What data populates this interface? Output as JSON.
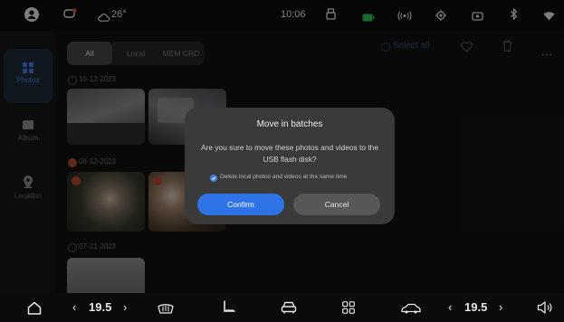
{
  "status_bar": {
    "weather": "26°",
    "time": "10:06"
  },
  "sidebar": {
    "items": [
      {
        "label": "Photos",
        "icon": "photos-icon",
        "active": true
      },
      {
        "label": "Album",
        "icon": "album-icon",
        "active": false
      },
      {
        "label": "Location",
        "icon": "location-icon",
        "active": false
      }
    ]
  },
  "gallery": {
    "tabs": [
      {
        "label": "All",
        "active": true
      },
      {
        "label": "Local",
        "active": false
      },
      {
        "label": "MEM CRD",
        "active": false
      }
    ],
    "toolbar": {
      "select_all": "Select all"
    },
    "groups": [
      {
        "date": "10-12-2023",
        "selected": false
      },
      {
        "date": "08-12-2023",
        "selected": true
      },
      {
        "date": "07-21-2023",
        "selected": false
      }
    ]
  },
  "dialog": {
    "title": "Move in batches",
    "message": "Are you sure to move these photos and videos to the USB flash disk?",
    "checkbox_label": "Delete local photos and videos at the same time",
    "checkbox_checked": true,
    "confirm_label": "Confirm",
    "cancel_label": "Cancel"
  },
  "bottom_bar": {
    "left_temp": "19.5",
    "right_temp": "19.5"
  },
  "colors": {
    "accent": "#2f74e6",
    "dialog_bg": "#3a3a3a",
    "selected_dot": "#b7492f"
  }
}
